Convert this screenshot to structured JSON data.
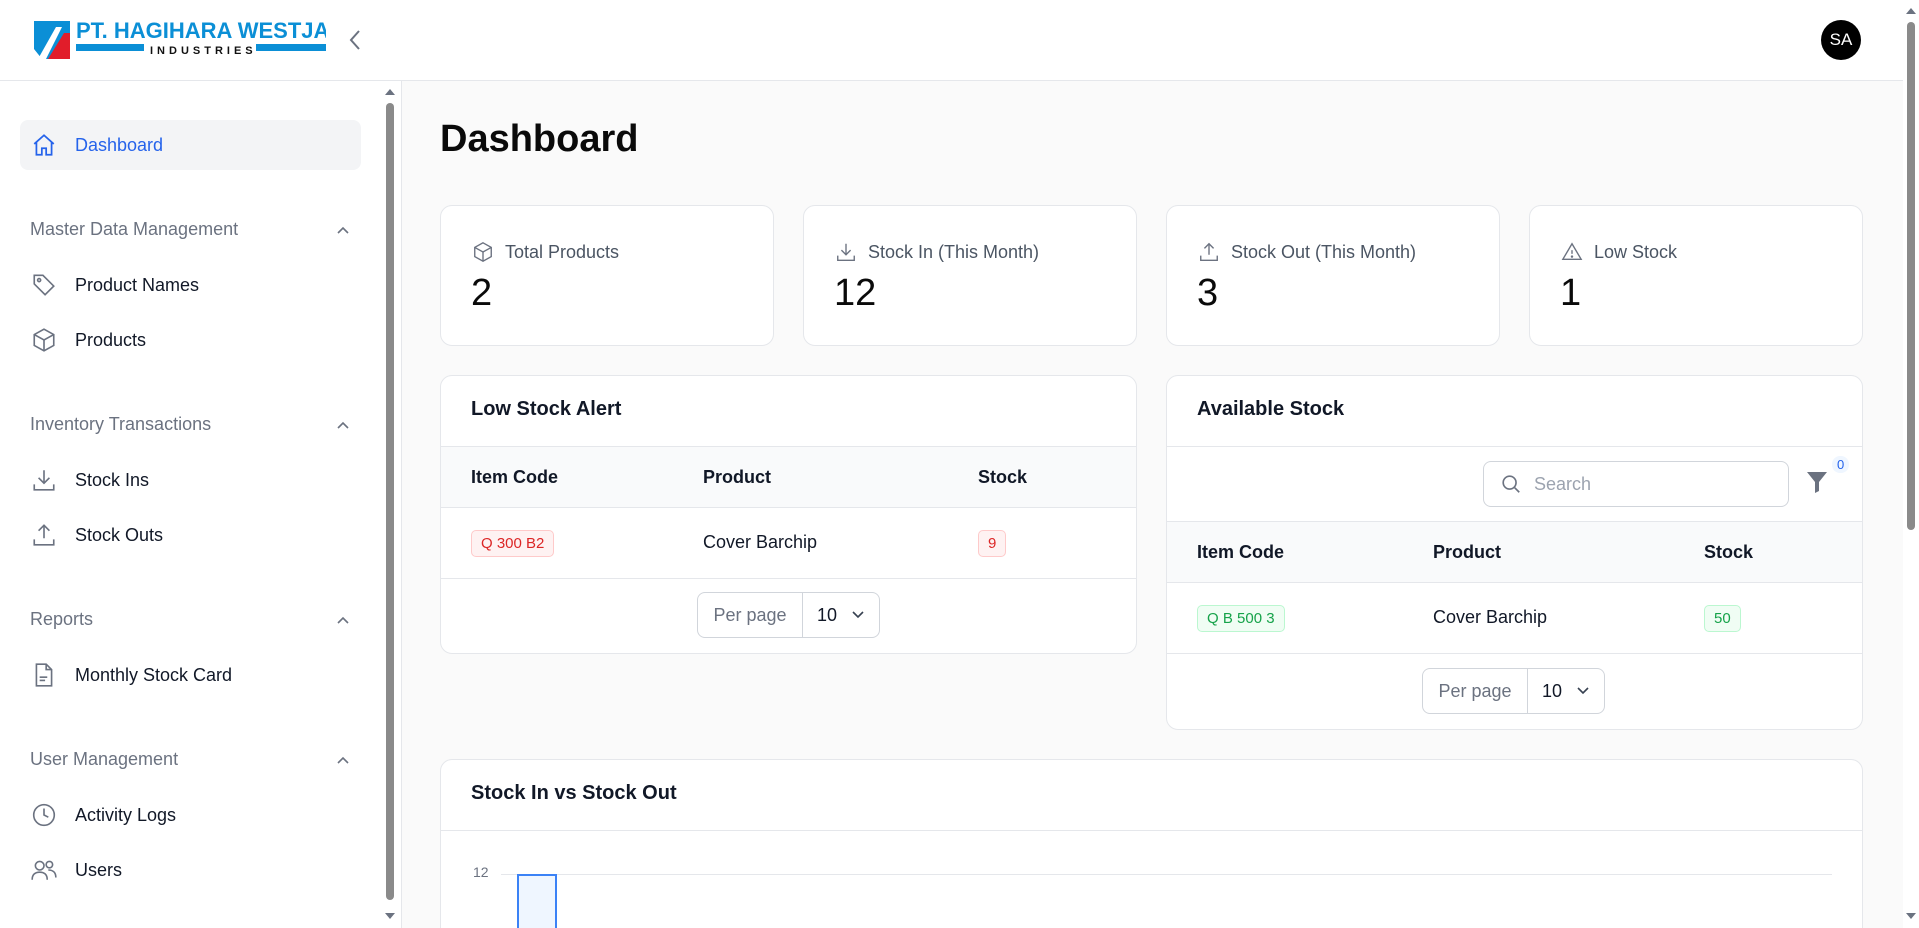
{
  "brand": {
    "company_line1": "PT. HAGIHARA WESTJAVA",
    "company_line2": "INDUSTRIES",
    "accent": "#0b8fd6"
  },
  "user": {
    "initials": "SA"
  },
  "sidebar": {
    "dashboard": "Dashboard",
    "groups": [
      {
        "label": "Master Data Management",
        "items": [
          "Product Names",
          "Products"
        ]
      },
      {
        "label": "Inventory Transactions",
        "items": [
          "Stock Ins",
          "Stock Outs"
        ]
      },
      {
        "label": "Reports",
        "items": [
          "Monthly Stock Card"
        ]
      },
      {
        "label": "User Management",
        "items": [
          "Activity Logs",
          "Users"
        ]
      }
    ]
  },
  "page": {
    "title": "Dashboard"
  },
  "stats": [
    {
      "label": "Total Products",
      "value": "2",
      "icon": "cube-icon"
    },
    {
      "label": "Stock In (This Month)",
      "value": "12",
      "icon": "download-icon"
    },
    {
      "label": "Stock Out (This Month)",
      "value": "3",
      "icon": "upload-icon"
    },
    {
      "label": "Low Stock",
      "value": "1",
      "icon": "warning-icon"
    }
  ],
  "low_stock": {
    "title": "Low Stock Alert",
    "columns": [
      "Item Code",
      "Product",
      "Stock"
    ],
    "rows": [
      {
        "code": "Q 300 B2",
        "product": "Cover Barchip",
        "stock": "9"
      }
    ],
    "per_page_label": "Per page",
    "per_page": "10"
  },
  "available": {
    "title": "Available Stock",
    "search_placeholder": "Search",
    "filter_count": "0",
    "columns": [
      "Item Code",
      "Product",
      "Stock"
    ],
    "rows": [
      {
        "code": "Q B 500 3",
        "product": "Cover Barchip",
        "stock": "50"
      }
    ],
    "per_page_label": "Per page",
    "per_page": "10"
  },
  "chart": {
    "title": "Stock In vs Stock Out",
    "y_tick_top": "12"
  },
  "chart_data": {
    "type": "bar",
    "title": "Stock In vs Stock Out",
    "ylim": [
      0,
      12
    ],
    "series": [
      {
        "values": [
          12
        ]
      }
    ]
  }
}
